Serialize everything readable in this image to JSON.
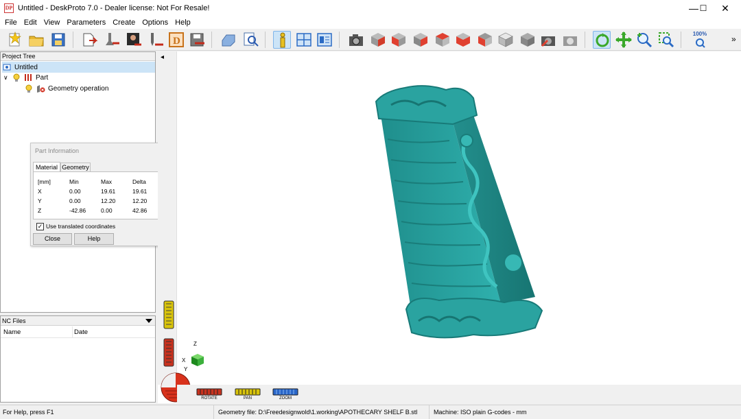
{
  "window": {
    "title": "Untitled - DeskProto 7.0 - Dealer license: Not For Resale!",
    "app_icon_text": "DP",
    "minimize_glyph": "—",
    "maximize_glyph": "☐",
    "close_glyph": "✕"
  },
  "menu": [
    "File",
    "Edit",
    "View",
    "Parameters",
    "Create",
    "Options",
    "Help"
  ],
  "toolbar": {
    "zoom_label": "100%",
    "overflow_glyph": "»"
  },
  "project_tree": {
    "header": "Project Tree",
    "items": [
      {
        "label": "Untitled",
        "selected": true
      },
      {
        "label": "Part"
      },
      {
        "label": "Geometry operation"
      }
    ]
  },
  "part_info": {
    "title": "Part Information",
    "tabs": [
      "Material",
      "Geometry"
    ],
    "columns": [
      "[mm]",
      "Min",
      "Max",
      "Delta"
    ],
    "rows": [
      [
        "X",
        "0.00",
        "19.61",
        "19.61"
      ],
      [
        "Y",
        "0.00",
        "12.20",
        "12.20"
      ],
      [
        "Z",
        "-42.86",
        "0.00",
        "42.86"
      ]
    ],
    "checkbox_label": "Use translated coordinates",
    "checkbox_checked": true,
    "close_label": "Close",
    "help_label": "Help"
  },
  "nc_files": {
    "header": "NC Files",
    "columns": [
      "Name",
      "Date"
    ]
  },
  "viewport": {
    "collapse_glyph": "◂",
    "axes": {
      "z": "Z",
      "x": "X",
      "y": "Y"
    },
    "model_color": "#2a9c9a",
    "controls": [
      "ROTATE",
      "PAN",
      "ZOOM"
    ]
  },
  "status": {
    "help": "For Help, press F1",
    "geometry": "Geometry file: D:\\Freedesignwold\\1.working\\APOTHECARY SHELF B.stl",
    "machine": "Machine: ISO plain G-codes - mm"
  }
}
